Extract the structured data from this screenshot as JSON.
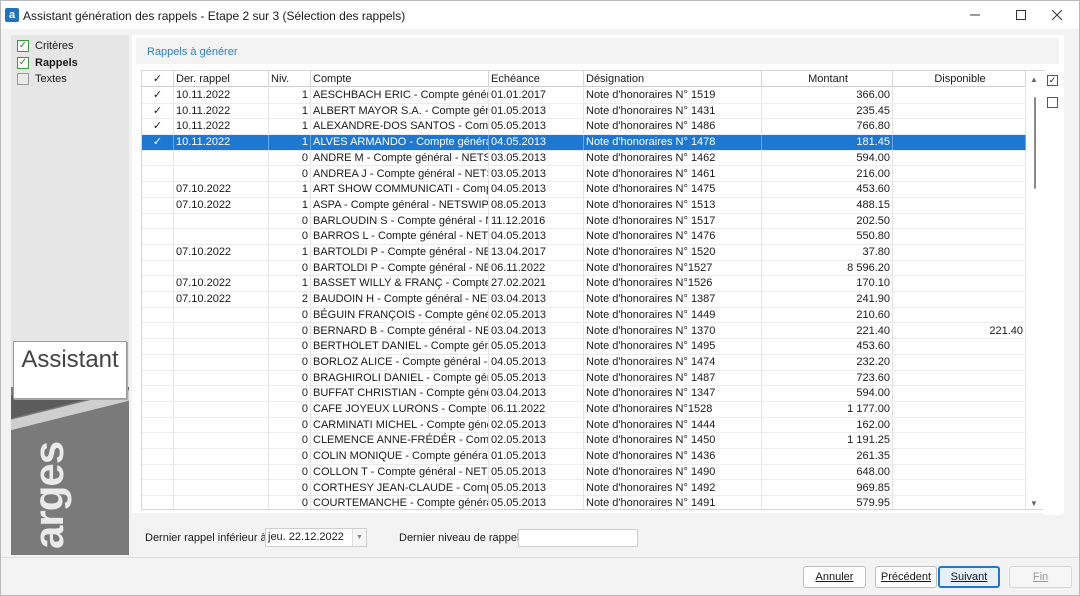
{
  "window": {
    "title": "Assistant génération des rappels - Etape 2 sur 3 (Sélection des rappels)",
    "app_letter": "a",
    "min": "—",
    "max": "☐",
    "close": "✕"
  },
  "steps": [
    {
      "label": "Critères",
      "state": "done",
      "mark": "✓"
    },
    {
      "label": "Rappels",
      "state": "current",
      "mark": "✓"
    },
    {
      "label": "Textes",
      "state": "pending",
      "mark": ""
    }
  ],
  "brand": {
    "assistant": "Assistant",
    "logo": "arges"
  },
  "panel": {
    "title": "Rappels à générer"
  },
  "columns": [
    "✓",
    "Der. rappel",
    "Niv.",
    "Compte",
    "Echéance",
    "Désignation",
    "Montant",
    "Disponible"
  ],
  "rows": [
    {
      "check": "✓",
      "last": "10.11.2022",
      "level": "1",
      "account": "AESCHBACH ERIC - Compte général - NETSWIPE",
      "due": "01.01.2017",
      "desc": "Note d'honoraires N° 1519",
      "amount": "366.00",
      "avail": ""
    },
    {
      "check": "✓",
      "last": "10.11.2022",
      "level": "1",
      "account": "ALBERT MAYOR S.A. - Compte général - NETSWIPE",
      "due": "01.05.2013",
      "desc": "Note d'honoraires N° 1431",
      "amount": "235.45",
      "avail": ""
    },
    {
      "check": "✓",
      "last": "10.11.2022",
      "level": "1",
      "account": "ALEXANDRE-DOS SANTOS - Compte général",
      "due": "05.05.2013",
      "desc": "Note d'honoraires N° 1486",
      "amount": "766.80",
      "avail": ""
    },
    {
      "check": "✓",
      "last": "10.11.2022",
      "level": "1",
      "account": "ALVES ARMANDO - Compte général - NETSWIPE",
      "due": "04.05.2013",
      "desc": "Note d'honoraires N° 1478",
      "amount": "181.45",
      "avail": "",
      "selected": true
    },
    {
      "check": "",
      "last": "",
      "level": "0",
      "account": "ANDRE M - Compte général - NETSWIPE",
      "due": "03.05.2013",
      "desc": "Note d'honoraires N° 1462",
      "amount": "594.00",
      "avail": ""
    },
    {
      "check": "",
      "last": "",
      "level": "0",
      "account": "ANDREA J - Compte général - NETSWIPE",
      "due": "03.05.2013",
      "desc": "Note d'honoraires N° 1461",
      "amount": "216.00",
      "avail": ""
    },
    {
      "check": "",
      "last": "07.10.2022",
      "level": "1",
      "account": "ART SHOW COMMUNICATI - Compte général",
      "due": "04.05.2013",
      "desc": "Note d'honoraires N° 1475",
      "amount": "453.60",
      "avail": ""
    },
    {
      "check": "",
      "last": "07.10.2022",
      "level": "1",
      "account": "ASPA - Compte général - NETSWIPE",
      "due": "08.05.2013",
      "desc": "Note d'honoraires N° 1513",
      "amount": "488.15",
      "avail": ""
    },
    {
      "check": "",
      "last": "",
      "level": "0",
      "account": "BARLOUDIN S - Compte général - NETSWIPE",
      "due": "11.12.2016",
      "desc": "Note d'honoraires N° 1517",
      "amount": "202.50",
      "avail": ""
    },
    {
      "check": "",
      "last": "",
      "level": "0",
      "account": "BARROS L - Compte général - NETSWIPE",
      "due": "04.05.2013",
      "desc": "Note d'honoraires N° 1476",
      "amount": "550.80",
      "avail": ""
    },
    {
      "check": "",
      "last": "07.10.2022",
      "level": "1",
      "account": "BARTOLDI P - Compte général - NETSWIPE",
      "due": "13.04.2017",
      "desc": "Note d'honoraires N° 1520",
      "amount": "37.80",
      "avail": ""
    },
    {
      "check": "",
      "last": "",
      "level": "0",
      "account": "BARTOLDI P - Compte général - NETSWIPE",
      "due": "06.11.2022",
      "desc": "Note d'honoraires N°1527",
      "amount": "8 596.20",
      "avail": ""
    },
    {
      "check": "",
      "last": "07.10.2022",
      "level": "1",
      "account": "BASSET WILLY & FRANÇ - Compte général",
      "due": "27.02.2021",
      "desc": "Note d'honoraires N°1526",
      "amount": "170.10",
      "avail": ""
    },
    {
      "check": "",
      "last": "07.10.2022",
      "level": "2",
      "account": "BAUDOIN H - Compte général - NETSWIPE",
      "due": "03.04.2013",
      "desc": "Note d'honoraires N° 1387",
      "amount": "241.90",
      "avail": ""
    },
    {
      "check": "",
      "last": "",
      "level": "0",
      "account": "BÉGUIN FRANÇOIS - Compte général - NETSWIPE",
      "due": "02.05.2013",
      "desc": "Note d'honoraires N° 1449",
      "amount": "210.60",
      "avail": ""
    },
    {
      "check": "",
      "last": "",
      "level": "0",
      "account": "BERNARD B - Compte général - NETSWIPE",
      "due": "03.04.2013",
      "desc": "Note d'honoraires N° 1370",
      "amount": "221.40",
      "avail": "221.40"
    },
    {
      "check": "",
      "last": "",
      "level": "0",
      "account": "BERTHOLET DANIEL - Compte général - NETSWIPE",
      "due": "05.05.2013",
      "desc": "Note d'honoraires N° 1495",
      "amount": "453.60",
      "avail": ""
    },
    {
      "check": "",
      "last": "",
      "level": "0",
      "account": "BORLOZ ALICE - Compte général - NETSWIPE",
      "due": "04.05.2013",
      "desc": "Note d'honoraires N° 1474",
      "amount": "232.20",
      "avail": ""
    },
    {
      "check": "",
      "last": "",
      "level": "0",
      "account": "BRAGHIROLI DANIEL - Compte général - NETSWIPE",
      "due": "05.05.2013",
      "desc": "Note d'honoraires N° 1487",
      "amount": "723.60",
      "avail": ""
    },
    {
      "check": "",
      "last": "",
      "level": "0",
      "account": "BUFFAT CHRISTIAN - Compte général - NETSWIPE",
      "due": "03.04.2013",
      "desc": "Note d'honoraires N° 1347",
      "amount": "594.00",
      "avail": ""
    },
    {
      "check": "",
      "last": "",
      "level": "0",
      "account": "CAFE JOYEUX LURONS - Compte général",
      "due": "06.11.2022",
      "desc": "Note d'honoraires N°1528",
      "amount": "1 177.00",
      "avail": ""
    },
    {
      "check": "",
      "last": "",
      "level": "0",
      "account": "CARMINATI MICHEL - Compte général - NETSWIPE",
      "due": "02.05.2013",
      "desc": "Note d'honoraires N° 1444",
      "amount": "162.00",
      "avail": ""
    },
    {
      "check": "",
      "last": "",
      "level": "0",
      "account": "CLEMENCE ANNE-FRÉDÉR - Compte général",
      "due": "02.05.2013",
      "desc": "Note d'honoraires N° 1450",
      "amount": "1 191.25",
      "avail": ""
    },
    {
      "check": "",
      "last": "",
      "level": "0",
      "account": "COLIN MONIQUE - Compte général - NETSWIPE",
      "due": "01.05.2013",
      "desc": "Note d'honoraires N° 1436",
      "amount": "261.35",
      "avail": ""
    },
    {
      "check": "",
      "last": "",
      "level": "0",
      "account": "COLLON T - Compte général - NETSWIPE",
      "due": "05.05.2013",
      "desc": "Note d'honoraires N° 1490",
      "amount": "648.00",
      "avail": ""
    },
    {
      "check": "",
      "last": "",
      "level": "0",
      "account": "CORTHESY JEAN-CLAUDE - Compte général",
      "due": "05.05.2013",
      "desc": "Note d'honoraires N° 1492",
      "amount": "969.85",
      "avail": ""
    },
    {
      "check": "",
      "last": "",
      "level": "0",
      "account": "COURTEMANCHE - Compte général - NETSWIPE",
      "due": "05.05.2013",
      "desc": "Note d'honoraires N° 1491",
      "amount": "579.95",
      "avail": ""
    }
  ],
  "right_tools": {
    "select_all": "✓",
    "select_none": ""
  },
  "filter": {
    "date_label": "Dernier rappel inférieur à",
    "date_value": "jeu. 22.12.2022",
    "level_label": "Dernier niveau de rappel",
    "level_value": ""
  },
  "buttons": {
    "cancel": "Annuler",
    "prev": "Précédent",
    "next": "Suivant",
    "finish": "Fin"
  }
}
